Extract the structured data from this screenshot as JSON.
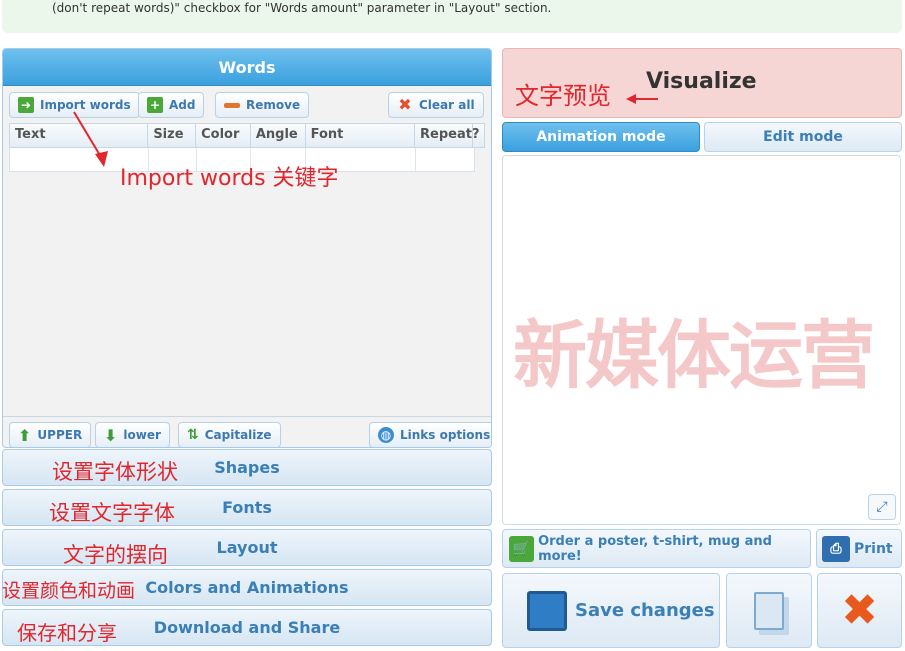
{
  "notice": {
    "text": "(don't repeat words)\" checkbox for \"Words amount\" parameter in \"Layout\" section."
  },
  "words_panel": {
    "title": "Words",
    "buttons": {
      "import": "Import words",
      "add": "Add",
      "remove": "Remove",
      "clear_all": "Clear all"
    },
    "columns": [
      "Text",
      "Size",
      "Color",
      "Angle",
      "Font",
      "Repeat?"
    ],
    "case_buttons": {
      "upper": "UPPER",
      "lower": "lower",
      "capitalize": "Capitalize",
      "links_options": "Links options"
    }
  },
  "sections": {
    "shapes": "Shapes",
    "fonts": "Fonts",
    "layout": "Layout",
    "colors": "Colors and Animations",
    "download": "Download and Share"
  },
  "visualize": {
    "label": "Visualize"
  },
  "tabs": {
    "animation": "Animation mode",
    "edit": "Edit mode"
  },
  "preview": {
    "cloud_text": "新媒体运营"
  },
  "actions": {
    "order": "Order a poster, t-shirt, mug and more!",
    "print": "Print",
    "save": "Save changes"
  },
  "annotations": {
    "import_words": "Import words 关键字",
    "visualize_cn": "文字预览",
    "shapes_cn": "设置字体形状",
    "fonts_cn": "设置文字字体",
    "layout_cn": "文字的摆向",
    "colors_cn": "设置颜色和动画",
    "download_cn": "保存和分享"
  },
  "colors": {
    "accent": "#3aa0de",
    "annotation_red": "#e2262d",
    "visualize_bg": "#f6d5d5"
  }
}
